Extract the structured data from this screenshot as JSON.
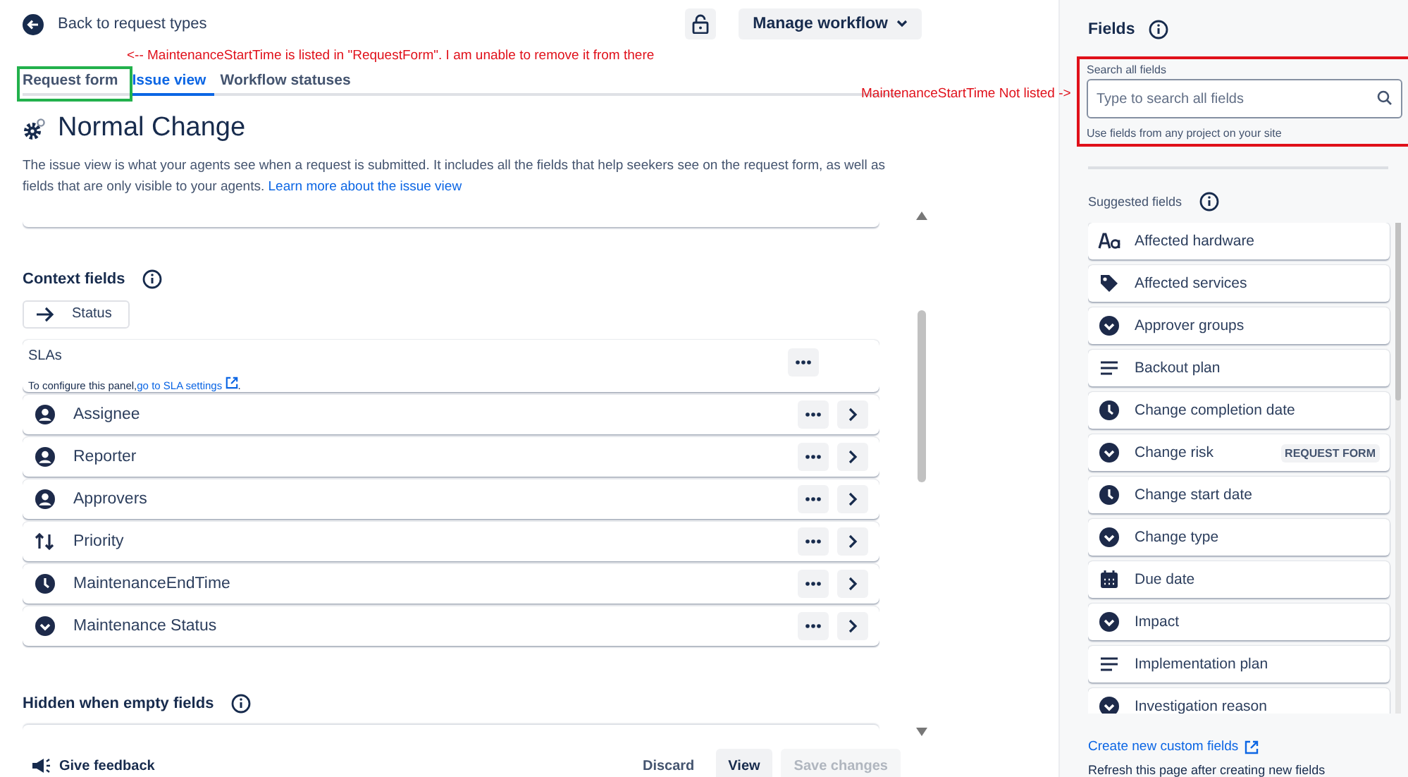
{
  "header": {
    "back_link": "Back to request types",
    "manage_workflow": "Manage workflow"
  },
  "annotations": [
    {
      "text": "<-- MaintenanceStartTime is listed in \"RequestForm\". I am unable to remove it from there"
    },
    {
      "text": "MaintenanceStartTime Not listed ->"
    }
  ],
  "tabs": [
    {
      "label": "Request form",
      "selected": false,
      "outlined": true
    },
    {
      "label": "Issue view",
      "selected": true,
      "outlined": false
    },
    {
      "label": "Workflow statuses",
      "selected": false,
      "outlined": false
    }
  ],
  "page": {
    "title": "Normal Change",
    "description": "The issue view is what your agents see when a request is submitted. It includes all the fields that help seekers see on the request form, as well as fields that are only visible to your agents.",
    "link": "Learn more about the issue view"
  },
  "context_fields": {
    "heading": "Context fields",
    "status_chip": "Status",
    "sla": {
      "title": "SLAs",
      "text": "To configure this panel,",
      "link": "go to SLA settings",
      "suffix": "."
    },
    "fields": [
      {
        "label": "Assignee",
        "kind": "user"
      },
      {
        "label": "Reporter",
        "kind": "user"
      },
      {
        "label": "Approvers",
        "kind": "user"
      },
      {
        "label": "Priority",
        "kind": "priority"
      },
      {
        "label": "MaintenanceEndTime",
        "kind": "clock"
      },
      {
        "label": "Maintenance Status",
        "kind": "select"
      }
    ]
  },
  "hidden_fields": {
    "heading": "Hidden when empty fields"
  },
  "footer": {
    "feedback": "Give feedback",
    "buttons": [
      {
        "label": "Discard",
        "kind": "subtle",
        "disabled": false
      },
      {
        "label": "View",
        "kind": "default",
        "disabled": false
      },
      {
        "label": "Save changes",
        "kind": "primary",
        "disabled": true
      }
    ]
  },
  "sidebar": {
    "title": "Fields",
    "search": {
      "label": "Search all fields",
      "placeholder": "Type to search all fields",
      "hint": "Use fields from any project on your site",
      "outlined": true
    },
    "suggested_heading": "Suggested fields",
    "suggested": [
      {
        "label": "Affected hardware",
        "kind": "text"
      },
      {
        "label": "Affected services",
        "kind": "tag"
      },
      {
        "label": "Approver groups",
        "kind": "select"
      },
      {
        "label": "Backout plan",
        "kind": "paragraph"
      },
      {
        "label": "Change completion date",
        "kind": "clock"
      },
      {
        "label": "Change risk",
        "kind": "select",
        "badge": "REQUEST FORM"
      },
      {
        "label": "Change start date",
        "kind": "clock"
      },
      {
        "label": "Change type",
        "kind": "select"
      },
      {
        "label": "Due date",
        "kind": "calendar"
      },
      {
        "label": "Impact",
        "kind": "select"
      },
      {
        "label": "Implementation plan",
        "kind": "paragraph"
      },
      {
        "label": "Investigation reason",
        "kind": "select"
      }
    ],
    "create_link": "Create new custom fields",
    "refresh_note": "Refresh this page after creating new fields"
  }
}
